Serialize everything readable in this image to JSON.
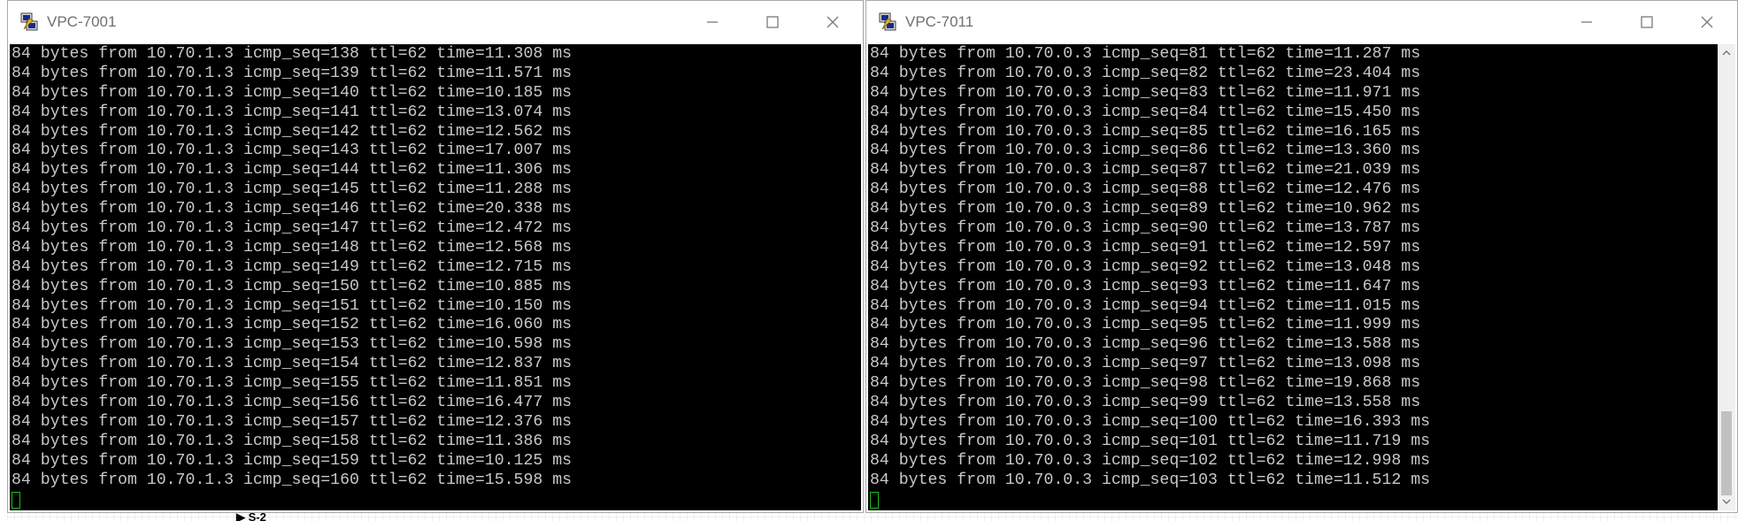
{
  "windows": {
    "left": {
      "title": "VPC-7001",
      "lines": [
        "84 bytes from 10.70.1.3 icmp_seq=138 ttl=62 time=11.308 ms",
        "84 bytes from 10.70.1.3 icmp_seq=139 ttl=62 time=11.571 ms",
        "84 bytes from 10.70.1.3 icmp_seq=140 ttl=62 time=10.185 ms",
        "84 bytes from 10.70.1.3 icmp_seq=141 ttl=62 time=13.074 ms",
        "84 bytes from 10.70.1.3 icmp_seq=142 ttl=62 time=12.562 ms",
        "84 bytes from 10.70.1.3 icmp_seq=143 ttl=62 time=17.007 ms",
        "84 bytes from 10.70.1.3 icmp_seq=144 ttl=62 time=11.306 ms",
        "84 bytes from 10.70.1.3 icmp_seq=145 ttl=62 time=11.288 ms",
        "84 bytes from 10.70.1.3 icmp_seq=146 ttl=62 time=20.338 ms",
        "84 bytes from 10.70.1.3 icmp_seq=147 ttl=62 time=12.472 ms",
        "84 bytes from 10.70.1.3 icmp_seq=148 ttl=62 time=12.568 ms",
        "84 bytes from 10.70.1.3 icmp_seq=149 ttl=62 time=12.715 ms",
        "84 bytes from 10.70.1.3 icmp_seq=150 ttl=62 time=10.885 ms",
        "84 bytes from 10.70.1.3 icmp_seq=151 ttl=62 time=10.150 ms",
        "84 bytes from 10.70.1.3 icmp_seq=152 ttl=62 time=16.060 ms",
        "84 bytes from 10.70.1.3 icmp_seq=153 ttl=62 time=10.598 ms",
        "84 bytes from 10.70.1.3 icmp_seq=154 ttl=62 time=12.837 ms",
        "84 bytes from 10.70.1.3 icmp_seq=155 ttl=62 time=11.851 ms",
        "84 bytes from 10.70.1.3 icmp_seq=156 ttl=62 time=16.477 ms",
        "84 bytes from 10.70.1.3 icmp_seq=157 ttl=62 time=12.376 ms",
        "84 bytes from 10.70.1.3 icmp_seq=158 ttl=62 time=11.386 ms",
        "84 bytes from 10.70.1.3 icmp_seq=159 ttl=62 time=10.125 ms",
        "84 bytes from 10.70.1.3 icmp_seq=160 ttl=62 time=15.598 ms"
      ]
    },
    "right": {
      "title": "VPC-7011",
      "lines": [
        "84 bytes from 10.70.0.3 icmp_seq=81 ttl=62 time=11.287 ms",
        "84 bytes from 10.70.0.3 icmp_seq=82 ttl=62 time=23.404 ms",
        "84 bytes from 10.70.0.3 icmp_seq=83 ttl=62 time=11.971 ms",
        "84 bytes from 10.70.0.3 icmp_seq=84 ttl=62 time=15.450 ms",
        "84 bytes from 10.70.0.3 icmp_seq=85 ttl=62 time=16.165 ms",
        "84 bytes from 10.70.0.3 icmp_seq=86 ttl=62 time=13.360 ms",
        "84 bytes from 10.70.0.3 icmp_seq=87 ttl=62 time=21.039 ms",
        "84 bytes from 10.70.0.3 icmp_seq=88 ttl=62 time=12.476 ms",
        "84 bytes from 10.70.0.3 icmp_seq=89 ttl=62 time=10.962 ms",
        "84 bytes from 10.70.0.3 icmp_seq=90 ttl=62 time=13.787 ms",
        "84 bytes from 10.70.0.3 icmp_seq=91 ttl=62 time=12.597 ms",
        "84 bytes from 10.70.0.3 icmp_seq=92 ttl=62 time=13.048 ms",
        "84 bytes from 10.70.0.3 icmp_seq=93 ttl=62 time=11.647 ms",
        "84 bytes from 10.70.0.3 icmp_seq=94 ttl=62 time=11.015 ms",
        "84 bytes from 10.70.0.3 icmp_seq=95 ttl=62 time=11.999 ms",
        "84 bytes from 10.70.0.3 icmp_seq=96 ttl=62 time=13.588 ms",
        "84 bytes from 10.70.0.3 icmp_seq=97 ttl=62 time=13.098 ms",
        "84 bytes from 10.70.0.3 icmp_seq=98 ttl=62 time=19.868 ms",
        "84 bytes from 10.70.0.3 icmp_seq=99 ttl=62 time=13.558 ms",
        "84 bytes from 10.70.0.3 icmp_seq=100 ttl=62 time=16.393 ms",
        "84 bytes from 10.70.0.3 icmp_seq=101 ttl=62 time=11.719 ms",
        "84 bytes from 10.70.0.3 icmp_seq=102 ttl=62 time=12.998 ms",
        "84 bytes from 10.70.0.3 icmp_seq=103 ttl=62 time=11.512 ms"
      ]
    }
  },
  "icons": {
    "app": "putty-terminal-icon",
    "minimize": "minimize-icon",
    "maximize": "maximize-icon",
    "close": "close-icon",
    "scroll_up": "scroll-up-arrow-icon",
    "scroll_down": "scroll-down-arrow-icon",
    "node_marker": "play-triangle-icon"
  },
  "colors": {
    "terminal_bg": "#000000",
    "terminal_text": "#c8c8c8",
    "cursor": "#18c018",
    "title_text": "#6f6f6f"
  },
  "canvas": {
    "node_label": "▶ S-2"
  }
}
